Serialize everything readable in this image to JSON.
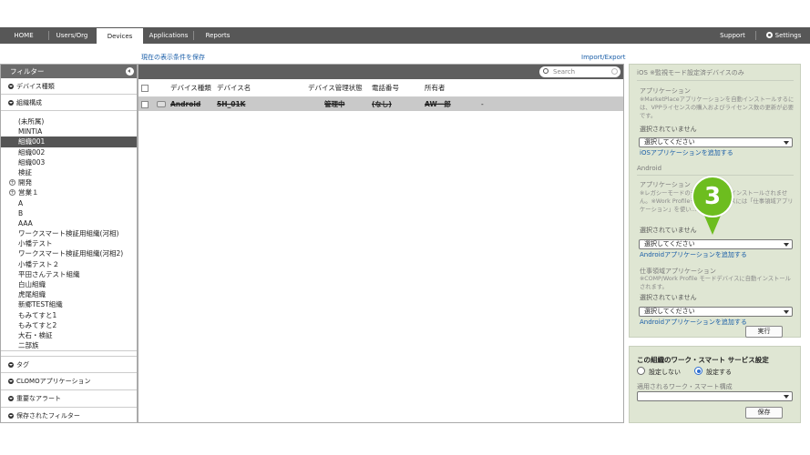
{
  "nav": {
    "items": [
      "HOME",
      "Users/Org",
      "Devices",
      "Applications",
      "Reports"
    ],
    "active": "Devices",
    "support": "Support",
    "settings": "Settings"
  },
  "toolbar": {
    "save_filter": "現在の表示条件を保存",
    "import_export": "Import/Export"
  },
  "sidebar": {
    "header": "フィルター",
    "sections_top": [
      "デバイス種類",
      "組織構成"
    ],
    "orgs": [
      "(未所属)",
      "MINTIA",
      "組織001",
      "組織002",
      "組織003",
      "検証",
      "開発",
      "営業１",
      "A",
      "B",
      "AAA",
      "ワークスマート検証用組織(河相)",
      "小幡テスト",
      "ワークスマート検証用組織(河相2)",
      "小幡テスト２",
      "平田さんテスト組織",
      "白山組織",
      "虎尾組織",
      "新郷TEST組織",
      "もみてすと1",
      "もみてすと2",
      "大石・検証",
      "二部族"
    ],
    "selected_org": "組織001",
    "sections_bottom": [
      "タグ",
      "CLOMOアプリケーション",
      "重要なアラート",
      "保存されたフィルター"
    ]
  },
  "grid": {
    "search_placeholder": "Search",
    "columns": [
      "デバイス種類",
      "デバイス名",
      "デバイス管理状態",
      "電話番号",
      "所有者"
    ],
    "row": {
      "type": "Android",
      "name": "5H_01K",
      "status": "管理中",
      "phone": "(なし)",
      "owner": "AW一郎",
      "extra": "-"
    }
  },
  "right_panel": {
    "ios_header": "iOS ※監視モード設定済デバイスのみ",
    "ios_app_title": "アプリケーション",
    "ios_app_note": "※MarketPlaceアプリケーションを自動インストールするには、VPPライセンスの購入およびライセンス数の更新が必要です。",
    "not_selected": "選択されていません",
    "select_placeholder": "選択してください",
    "ios_add_link": "iOSアプリケーションを追加する",
    "android_header": "Android",
    "android_app_title": "アプリケーション",
    "android_app_note": "※レガシーモードのデバイスに自動インストールされません。※Work Profileモードのデバイスには「仕事領域アプリケーション」を使い...",
    "android_add_link": "Androidアプリケーションを追加する",
    "work_app_title": "仕事領域アプリケーション",
    "work_app_note": "※COMP/Work Profile モードデバイスに自動インストールされます。",
    "execute_button": "実行",
    "ws_title": "この組織のワーク・スマート サービス設定",
    "ws_off": "設定しない",
    "ws_on": "設定する",
    "ws_config_label": "適用されるワーク・スマート構成",
    "save_button": "保存"
  },
  "callout": {
    "number": "3",
    "color": "#6dbd1f"
  }
}
